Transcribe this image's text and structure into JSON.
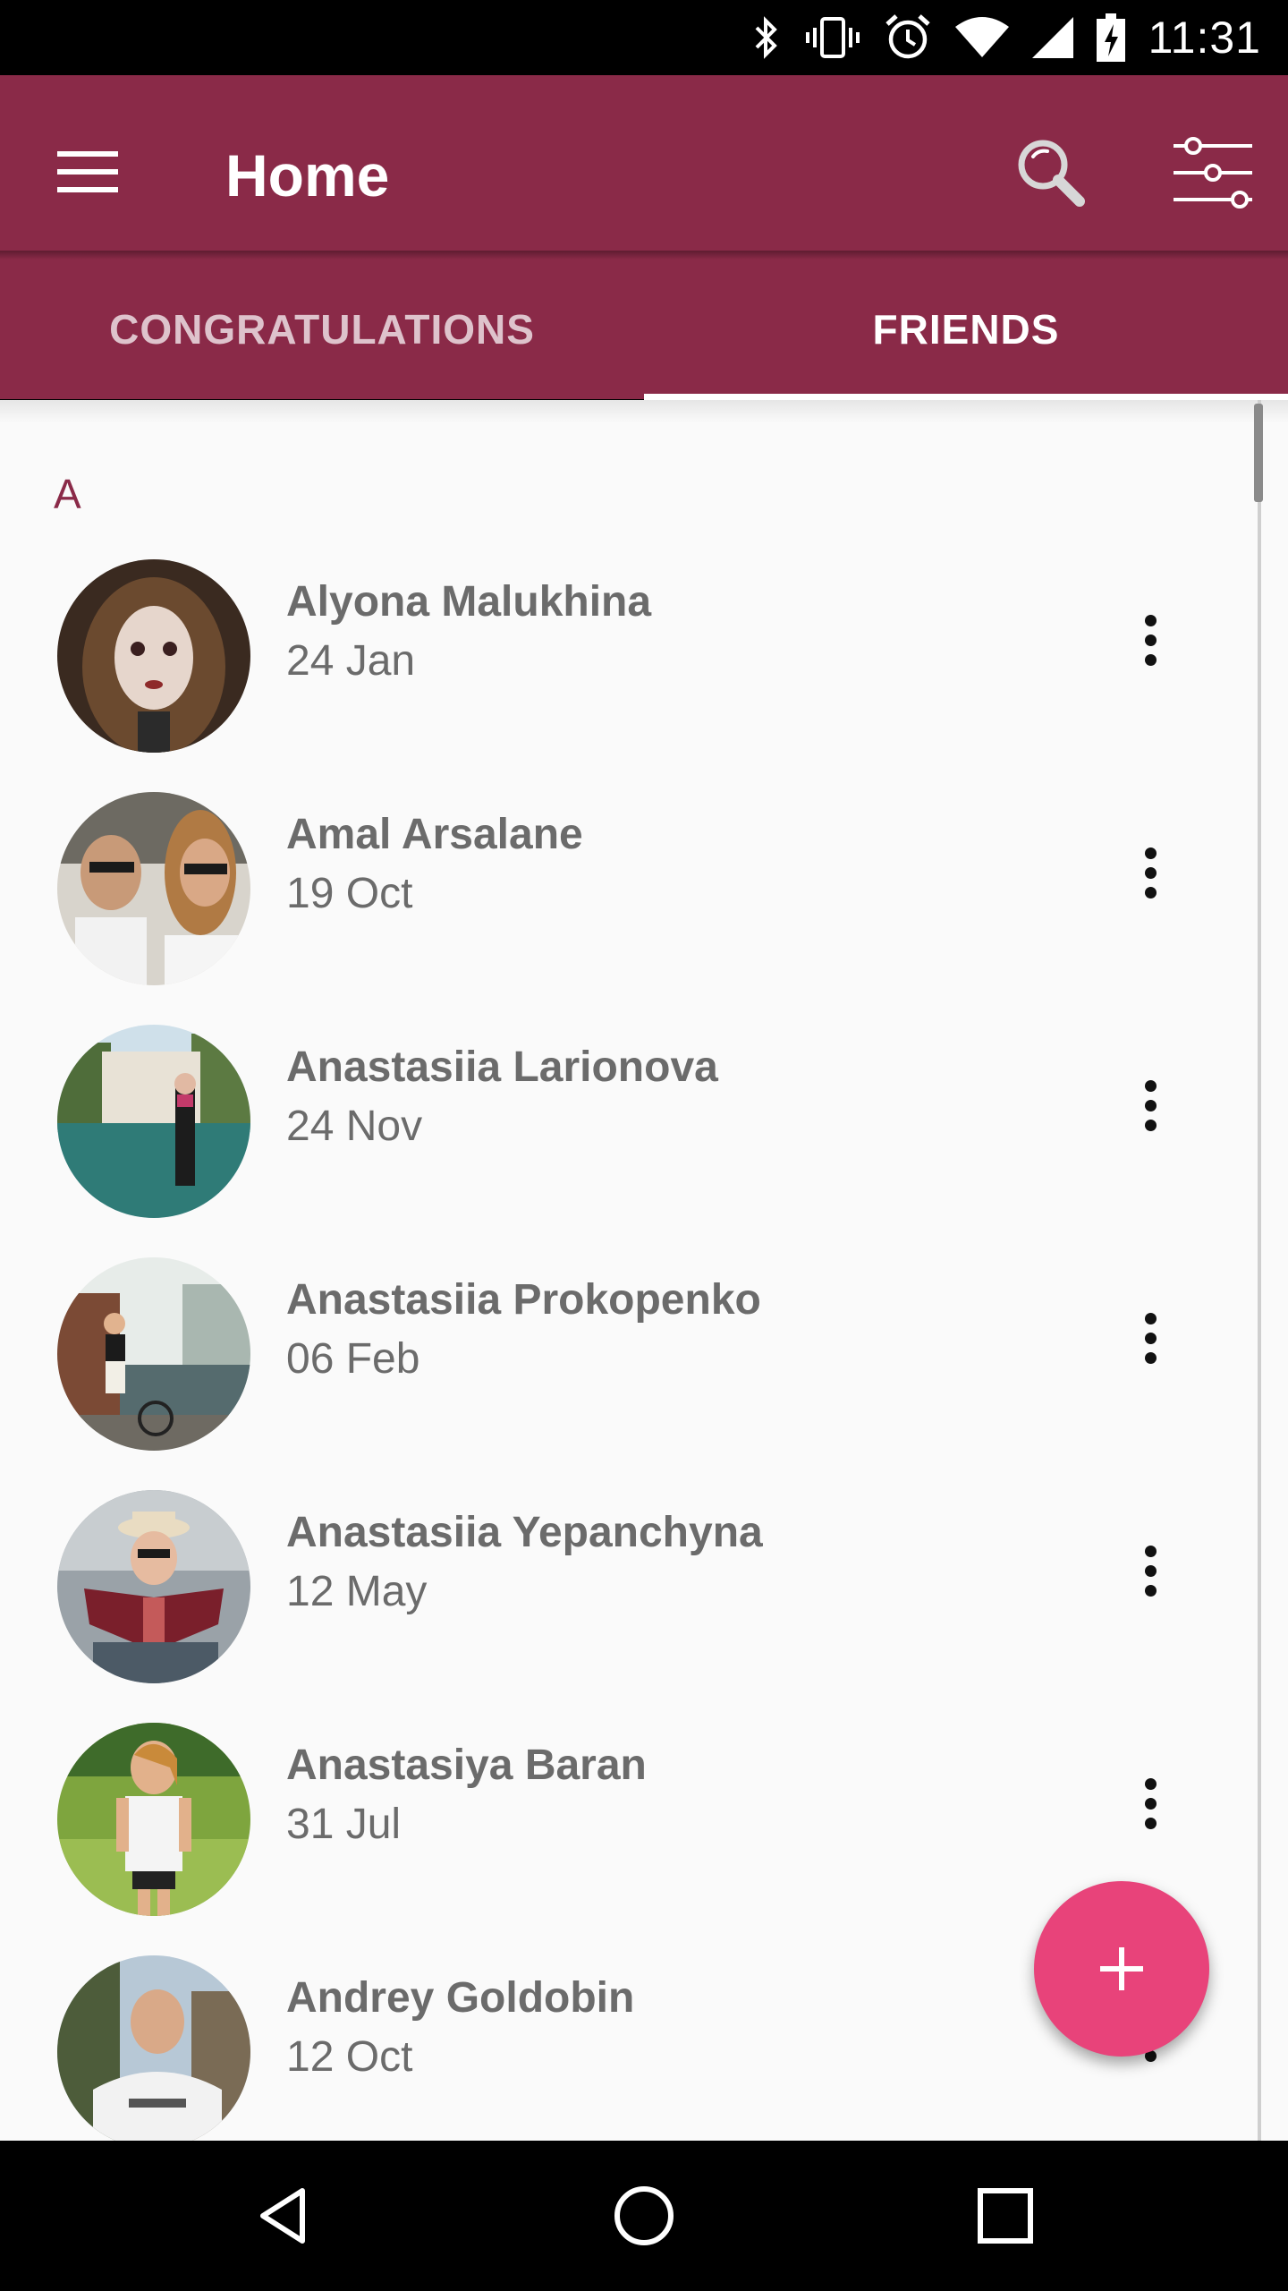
{
  "status_bar": {
    "time": "11:31",
    "icons": [
      "bluetooth-icon",
      "vibrate-icon",
      "alarm-icon",
      "wifi-icon",
      "cell-signal-icon",
      "battery-charging-icon"
    ]
  },
  "app_bar": {
    "title": "Home",
    "color": "#8a2a48",
    "menu_icon": "hamburger-menu-icon",
    "search_icon": "search-icon",
    "filter_icon": "filter-sliders-icon"
  },
  "tabs": [
    {
      "label": "CONGRATULATIONS",
      "active": false
    },
    {
      "label": "FRIENDS",
      "active": true
    }
  ],
  "friends": {
    "section_letter": "A",
    "items": [
      {
        "name": "Alyona Malukhina",
        "date": "24 Jan"
      },
      {
        "name": "Amal Arsalane",
        "date": "19 Oct"
      },
      {
        "name": "Anastasiia Larionova",
        "date": "24 Nov"
      },
      {
        "name": "Anastasiia Prokopenko",
        "date": "06 Feb"
      },
      {
        "name": "Anastasiia Yepanchyna",
        "date": "12 May"
      },
      {
        "name": "Anastasiya Baran",
        "date": "31 Jul"
      },
      {
        "name": "Andrey Goldobin",
        "date": "12 Oct"
      }
    ]
  },
  "fab": {
    "icon": "plus-icon",
    "color": "#e8437a"
  },
  "nav_bar": {
    "icons": [
      "back-icon",
      "home-icon",
      "recents-icon"
    ]
  }
}
